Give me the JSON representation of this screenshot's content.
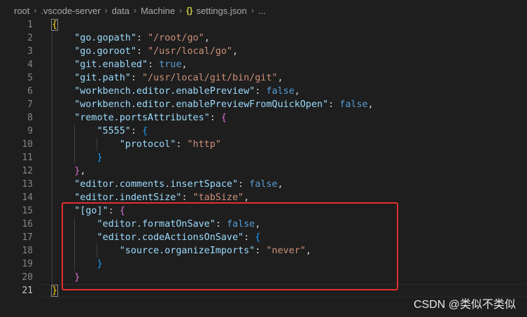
{
  "breadcrumb": {
    "items": [
      "root",
      ".vscode-server",
      "data",
      "Machine"
    ],
    "file_icon": "{}",
    "file_name": "settings.json",
    "ellipsis": "..."
  },
  "editor": {
    "line_numbers": [
      "1",
      "2",
      "3",
      "4",
      "5",
      "6",
      "7",
      "8",
      "9",
      "10",
      "11",
      "12",
      "13",
      "14",
      "15",
      "16",
      "17",
      "18",
      "19",
      "20",
      "21"
    ],
    "active_line": 21,
    "lines": [
      [
        {
          "t": "{",
          "c": "b1"
        }
      ],
      [
        {
          "t": "    ",
          "c": "punct"
        },
        {
          "t": "\"go.gopath\"",
          "c": "key"
        },
        {
          "t": ": ",
          "c": "punct"
        },
        {
          "t": "\"/root/go\"",
          "c": "str"
        },
        {
          "t": ",",
          "c": "punct"
        }
      ],
      [
        {
          "t": "    ",
          "c": "punct"
        },
        {
          "t": "\"go.goroot\"",
          "c": "key"
        },
        {
          "t": ": ",
          "c": "punct"
        },
        {
          "t": "\"/usr/local/go\"",
          "c": "str"
        },
        {
          "t": ",",
          "c": "punct"
        }
      ],
      [
        {
          "t": "    ",
          "c": "punct"
        },
        {
          "t": "\"git.enabled\"",
          "c": "key"
        },
        {
          "t": ": ",
          "c": "punct"
        },
        {
          "t": "true",
          "c": "kw"
        },
        {
          "t": ",",
          "c": "punct"
        }
      ],
      [
        {
          "t": "    ",
          "c": "punct"
        },
        {
          "t": "\"git.path\"",
          "c": "key"
        },
        {
          "t": ": ",
          "c": "punct"
        },
        {
          "t": "\"/usr/local/git/bin/git\"",
          "c": "str"
        },
        {
          "t": ",",
          "c": "punct"
        }
      ],
      [
        {
          "t": "    ",
          "c": "punct"
        },
        {
          "t": "\"workbench.editor.enablePreview\"",
          "c": "key"
        },
        {
          "t": ": ",
          "c": "punct"
        },
        {
          "t": "false",
          "c": "kw"
        },
        {
          "t": ",",
          "c": "punct"
        }
      ],
      [
        {
          "t": "    ",
          "c": "punct"
        },
        {
          "t": "\"workbench.editor.enablePreviewFromQuickOpen\"",
          "c": "key"
        },
        {
          "t": ": ",
          "c": "punct"
        },
        {
          "t": "false",
          "c": "kw"
        },
        {
          "t": ",",
          "c": "punct"
        }
      ],
      [
        {
          "t": "    ",
          "c": "punct"
        },
        {
          "t": "\"remote.portsAttributes\"",
          "c": "key"
        },
        {
          "t": ": ",
          "c": "punct"
        },
        {
          "t": "{",
          "c": "b2"
        }
      ],
      [
        {
          "t": "        ",
          "c": "punct"
        },
        {
          "t": "\"5555\"",
          "c": "key"
        },
        {
          "t": ": ",
          "c": "punct"
        },
        {
          "t": "{",
          "c": "b3"
        }
      ],
      [
        {
          "t": "            ",
          "c": "punct"
        },
        {
          "t": "\"protocol\"",
          "c": "key"
        },
        {
          "t": ": ",
          "c": "punct"
        },
        {
          "t": "\"http\"",
          "c": "str"
        }
      ],
      [
        {
          "t": "        ",
          "c": "punct"
        },
        {
          "t": "}",
          "c": "b3"
        }
      ],
      [
        {
          "t": "    ",
          "c": "punct"
        },
        {
          "t": "}",
          "c": "b2"
        },
        {
          "t": ",",
          "c": "punct"
        }
      ],
      [
        {
          "t": "    ",
          "c": "punct"
        },
        {
          "t": "\"editor.comments.insertSpace\"",
          "c": "key"
        },
        {
          "t": ": ",
          "c": "punct"
        },
        {
          "t": "false",
          "c": "kw"
        },
        {
          "t": ",",
          "c": "punct"
        }
      ],
      [
        {
          "t": "    ",
          "c": "punct"
        },
        {
          "t": "\"editor.indentSize\"",
          "c": "key"
        },
        {
          "t": ": ",
          "c": "punct"
        },
        {
          "t": "\"tabSize\"",
          "c": "str"
        },
        {
          "t": ",",
          "c": "punct"
        }
      ],
      [
        {
          "t": "    ",
          "c": "punct"
        },
        {
          "t": "\"[go]\"",
          "c": "key"
        },
        {
          "t": ": ",
          "c": "punct"
        },
        {
          "t": "{",
          "c": "b2"
        }
      ],
      [
        {
          "t": "        ",
          "c": "punct"
        },
        {
          "t": "\"editor.formatOnSave\"",
          "c": "key"
        },
        {
          "t": ": ",
          "c": "punct"
        },
        {
          "t": "false",
          "c": "kw"
        },
        {
          "t": ",",
          "c": "punct"
        }
      ],
      [
        {
          "t": "        ",
          "c": "punct"
        },
        {
          "t": "\"editor.codeActionsOnSave\"",
          "c": "key"
        },
        {
          "t": ": ",
          "c": "punct"
        },
        {
          "t": "{",
          "c": "b3"
        }
      ],
      [
        {
          "t": "            ",
          "c": "punct"
        },
        {
          "t": "\"source.organizeImports\"",
          "c": "key"
        },
        {
          "t": ": ",
          "c": "punct"
        },
        {
          "t": "\"never\"",
          "c": "str"
        },
        {
          "t": ",",
          "c": "punct"
        }
      ],
      [
        {
          "t": "        ",
          "c": "punct"
        },
        {
          "t": "}",
          "c": "b3"
        }
      ],
      [
        {
          "t": "    ",
          "c": "punct"
        },
        {
          "t": "}",
          "c": "b2"
        }
      ],
      [
        {
          "t": "}",
          "c": "b1"
        }
      ]
    ]
  },
  "watermark": "CSDN @类似不类似",
  "colors": {
    "background": "#1e1e1e",
    "key": "#9cdcfe",
    "string": "#ce9178",
    "keyword": "#569cd6",
    "bracket_level1": "#ffd700",
    "bracket_level2": "#da70d6",
    "bracket_level3": "#179fff",
    "annotation_box": "#e0302e"
  }
}
